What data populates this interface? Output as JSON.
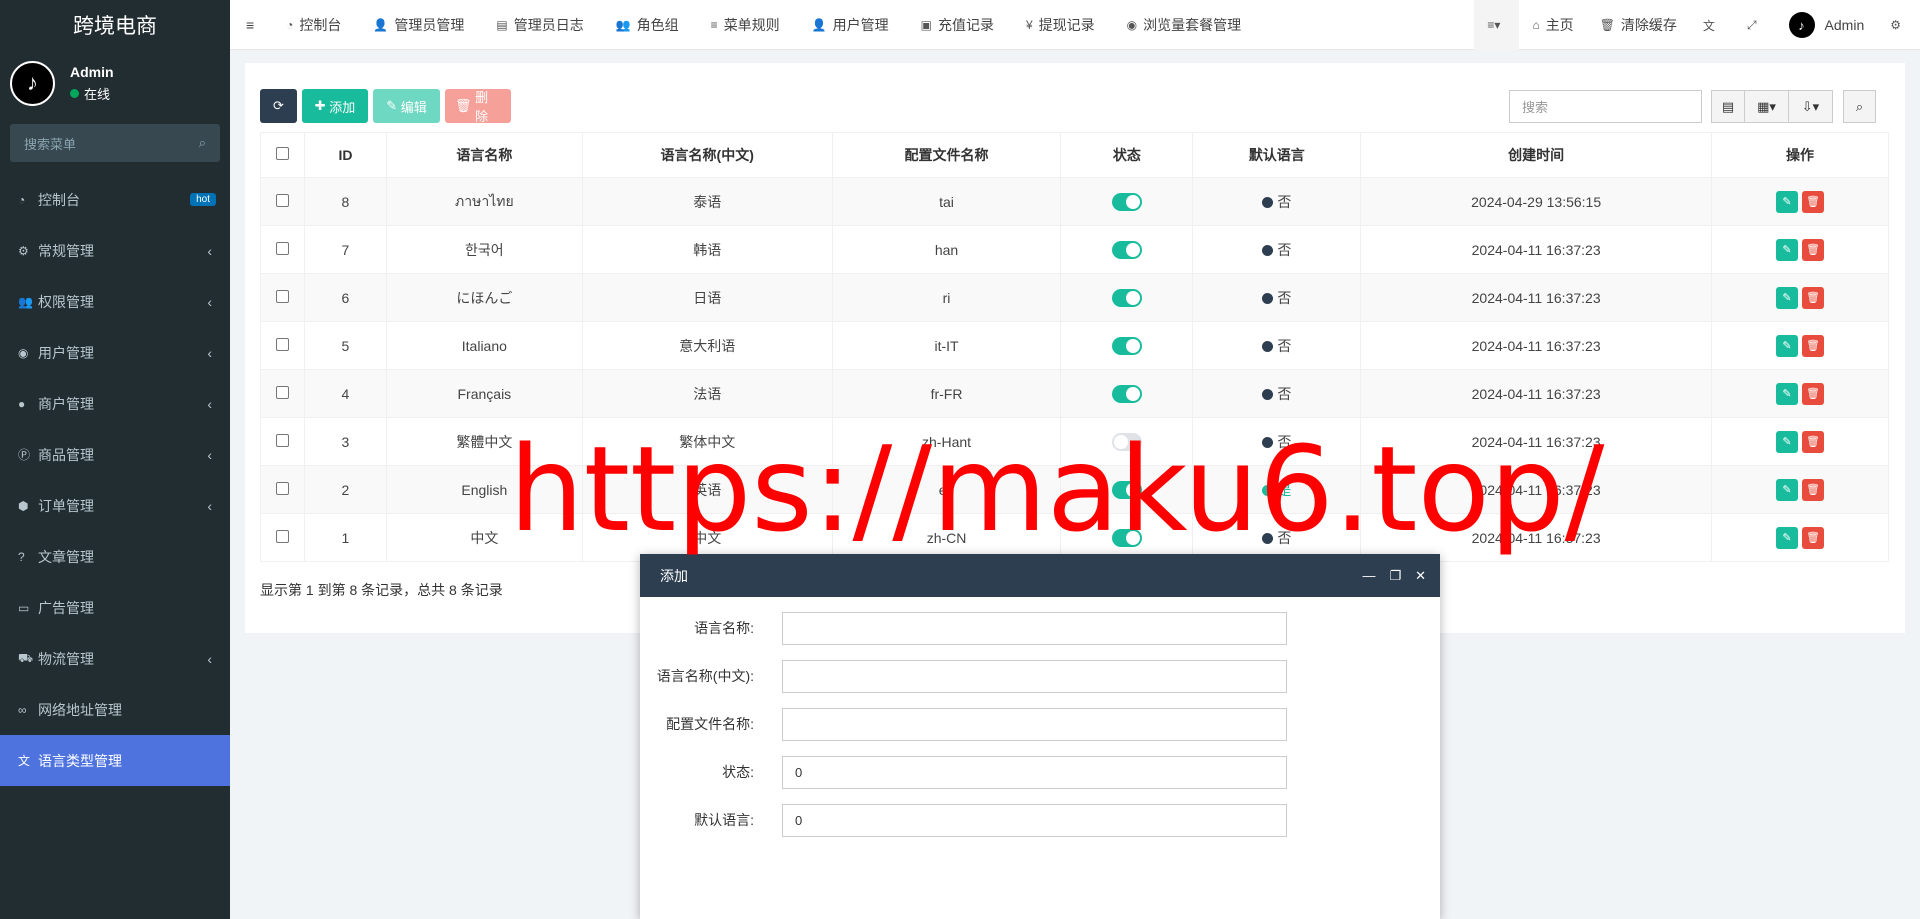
{
  "app": {
    "title": "跨境电商"
  },
  "user": {
    "name": "Admin",
    "status": "在线",
    "avatar_glyph": "♪"
  },
  "sidebar": {
    "search_placeholder": "搜索菜单",
    "items": [
      {
        "label": "控制台",
        "icon": "dashboard-icon",
        "badge": "hot"
      },
      {
        "label": "常规管理",
        "icon": "cogs-icon",
        "arrow": "‹"
      },
      {
        "label": "权限管理",
        "icon": "users-icon",
        "arrow": "‹"
      },
      {
        "label": "用户管理",
        "icon": "user-circle-icon",
        "arrow": "‹"
      },
      {
        "label": "商户管理",
        "icon": "apple-icon",
        "arrow": "‹"
      },
      {
        "label": "商品管理",
        "icon": "product-icon",
        "arrow": "‹"
      },
      {
        "label": "订单管理",
        "icon": "cube-icon",
        "arrow": "‹"
      },
      {
        "label": "文章管理",
        "icon": "question-icon"
      },
      {
        "label": "广告管理",
        "icon": "card-icon"
      },
      {
        "label": "物流管理",
        "icon": "truck-icon",
        "arrow": "‹"
      },
      {
        "label": "网络地址管理",
        "icon": "link-icon"
      },
      {
        "label": "语言类型管理",
        "icon": "language-icon",
        "active": true
      }
    ]
  },
  "topnav": {
    "items": [
      "控制台",
      "管理员管理",
      "管理员日志",
      "角色组",
      "菜单规则",
      "用户管理",
      "充值记录",
      "提现记录",
      "浏览量套餐管理"
    ],
    "home": "主页",
    "clear_cache": "清除缓存",
    "admin": "Admin"
  },
  "toolbar": {
    "add": "添加",
    "edit": "编辑",
    "delete": "删除",
    "search_placeholder": "搜索"
  },
  "table": {
    "headers": [
      "ID",
      "语言名称",
      "语言名称(中文)",
      "配置文件名称",
      "状态",
      "默认语言",
      "创建时间",
      "操作"
    ],
    "rows": [
      {
        "id": "8",
        "name": "ภาษาไทย",
        "name_cn": "泰语",
        "file": "tai",
        "status": true,
        "default": "否",
        "created": "2024-04-29 13:56:15"
      },
      {
        "id": "7",
        "name": "한국어",
        "name_cn": "韩语",
        "file": "han",
        "status": true,
        "default": "否",
        "created": "2024-04-11 16:37:23"
      },
      {
        "id": "6",
        "name": "にほんご",
        "name_cn": "日语",
        "file": "ri",
        "status": true,
        "default": "否",
        "created": "2024-04-11 16:37:23"
      },
      {
        "id": "5",
        "name": "Italiano",
        "name_cn": "意大利语",
        "file": "it-IT",
        "status": true,
        "default": "否",
        "created": "2024-04-11 16:37:23"
      },
      {
        "id": "4",
        "name": "Français",
        "name_cn": "法语",
        "file": "fr-FR",
        "status": true,
        "default": "否",
        "created": "2024-04-11 16:37:23"
      },
      {
        "id": "3",
        "name": "繁體中文",
        "name_cn": "繁体中文",
        "file": "zh-Hant",
        "status": false,
        "default": "否",
        "created": "2024-04-11 16:37:23"
      },
      {
        "id": "2",
        "name": "English",
        "name_cn": "英语",
        "file": "en",
        "status": true,
        "default": "是",
        "created": "2024-04-11 16:37:23"
      },
      {
        "id": "1",
        "name": "中文",
        "name_cn": "中文",
        "file": "zh-CN",
        "status": true,
        "default": "否",
        "created": "2024-04-11 16:37:23"
      }
    ]
  },
  "pager": {
    "summary": "显示第 1 到第 8 条记录，总共 8 条记录"
  },
  "watermark": "https://maku6.top/",
  "dialog": {
    "title": "添加",
    "fields": [
      {
        "label": "语言名称:",
        "value": ""
      },
      {
        "label": "语言名称(中文):",
        "value": ""
      },
      {
        "label": "配置文件名称:",
        "value": ""
      },
      {
        "label": "状态:",
        "value": "0"
      },
      {
        "label": "默认语言:",
        "value": "0"
      }
    ]
  },
  "colors": {
    "sidebar_bg": "#222d32",
    "active": "#4e73df",
    "accent": "#18bc9c",
    "danger": "#e74c3c",
    "dark": "#2c3e50"
  }
}
